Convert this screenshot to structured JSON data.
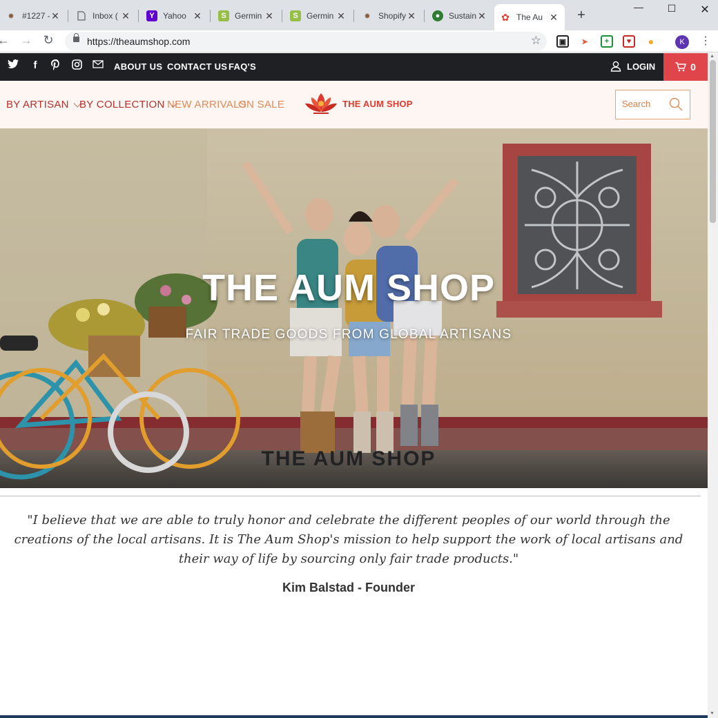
{
  "browser": {
    "tabs": [
      {
        "title": "#1227 -",
        "icon": "aum-icon"
      },
      {
        "title": "Inbox (",
        "icon": "page-icon"
      },
      {
        "title": "Yahoo",
        "icon": "yahoo-icon"
      },
      {
        "title": "Germin",
        "icon": "shopify-icon"
      },
      {
        "title": "Germin",
        "icon": "shopify-icon"
      },
      {
        "title": "Shopify",
        "icon": "aum-icon"
      },
      {
        "title": "Sustain",
        "icon": "globe-icon"
      },
      {
        "title": "The Au",
        "icon": "lotus-icon"
      }
    ],
    "url": "https://theaumshop.com",
    "profile_initial": "K"
  },
  "topbar": {
    "links": [
      "ABOUT US",
      "CONTACT US",
      "FAQ'S"
    ],
    "login_label": "LOGIN",
    "cart_count": "0"
  },
  "nav": {
    "items": [
      {
        "label": "BY ARTISAN",
        "dropdown": true
      },
      {
        "label": "BY COLLECTION",
        "dropdown": true
      },
      {
        "label": "NEW ARRIVALS",
        "dropdown": false
      },
      {
        "label": "ON SALE",
        "dropdown": false
      }
    ],
    "logo_text": "THE AUM SHOP",
    "search_placeholder": "Search"
  },
  "hero": {
    "title": "THE AUM SHOP",
    "subtitle": "FAIR TRADE GOODS FROM GLOBAL ARTISANS"
  },
  "content": {
    "title": "THE AUM SHOP",
    "quote": "\"I believe that we are able to truly honor and celebrate the different peoples of our world through the creations of the local artisans.  It is The Aum Shop's mission to help support the work of local artisans and their way of life by sourcing only fair trade products.\"",
    "founder": "Kim Balstad - Founder"
  },
  "colors": {
    "accent_red": "#e0454b",
    "nav_dark_red": "#b5302a",
    "nav_orange": "#e08a5a",
    "topbar": "#1f2024"
  }
}
